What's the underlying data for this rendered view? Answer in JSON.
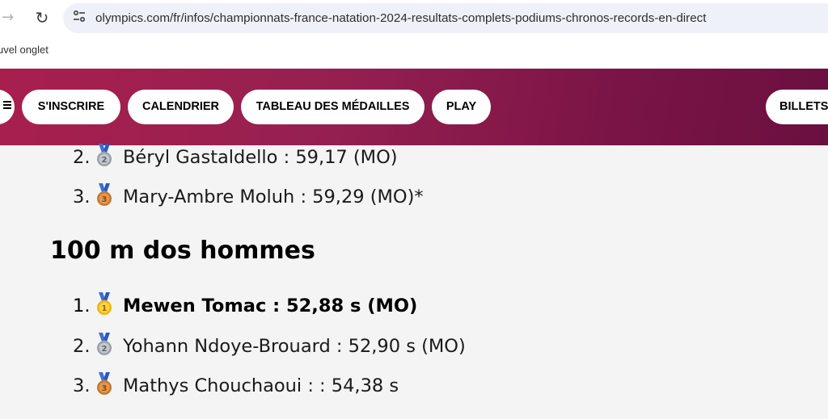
{
  "browser": {
    "url": "olympics.com/fr/infos/championnats-france-natation-2024-resultats-complets-podiums-chronos-records-en-direct",
    "bookmark_label": "uvel onglet",
    "forward_icon": "arrow-right-icon",
    "reload_icon": "reload-icon"
  },
  "nav": {
    "items": [
      "S'INSCRIRE",
      "CALENDRIER",
      "TABLEAU DES MÉDAILLES",
      "PLAY",
      "BILLETS"
    ],
    "colors": {
      "band_start": "#a81f4e",
      "band_end": "#6a1040",
      "pill": "#ffffff"
    }
  },
  "content": {
    "prev_results": [
      {
        "rank": "2.",
        "medal": "silver",
        "text": "Béryl Gastaldello : 59,17 (MO)"
      },
      {
        "rank": "3.",
        "medal": "bronze",
        "text": "Mary-Ambre Moluh : 59,29 (MO)*"
      }
    ],
    "heading": "100 m dos hommes",
    "results": [
      {
        "rank": "1.",
        "medal": "gold",
        "text": "Mewen Tomac : 52,88 s (MO)",
        "bold": true
      },
      {
        "rank": "2.",
        "medal": "silver",
        "text": "Yohann Ndoye-Brouard : 52,90 s (MO)"
      },
      {
        "rank": "3.",
        "medal": "bronze",
        "text": "Mathys Chouchaoui : : 54,38 s"
      }
    ],
    "medal_colors": {
      "gold": "#f5b400",
      "silver": "#9aa1a8",
      "bronze": "#c9772c"
    }
  }
}
